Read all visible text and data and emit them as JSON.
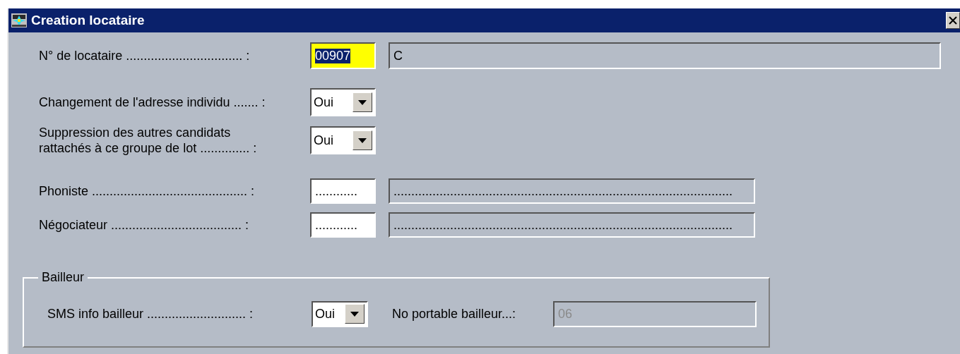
{
  "window": {
    "title": "Creation locataire"
  },
  "rows": [
    {
      "label": "N° de locataire ................................. :",
      "controls": [
        {
          "kind": "text",
          "value": "00907",
          "focused": true
        },
        {
          "kind": "display",
          "value": "C"
        }
      ]
    },
    {
      "label": "Changement de l'adresse individu ....... :",
      "controls": [
        {
          "kind": "select",
          "value": "Oui"
        }
      ]
    },
    {
      "label": "Suppression des autres candidats\nrattachés à ce groupe de lot .............. :",
      "controls": [
        {
          "kind": "select",
          "value": "Oui"
        }
      ]
    },
    {
      "label": "Phoniste ............................................ :",
      "controls": [
        {
          "kind": "text",
          "value": "............",
          "focused": false
        },
        {
          "kind": "display",
          "value": "................................................................................................"
        }
      ]
    },
    {
      "label": "Négociateur  ..................................... :",
      "controls": [
        {
          "kind": "text",
          "value": "............",
          "focused": false
        },
        {
          "kind": "display",
          "value": "................................................................................................"
        }
      ]
    }
  ],
  "group": {
    "title": "Bailleur",
    "label": "SMS info bailleur ............................ :",
    "select": {
      "value": "Oui"
    },
    "field_label": "No portable bailleur...:",
    "field": {
      "value": "06",
      "disabled": true
    }
  }
}
